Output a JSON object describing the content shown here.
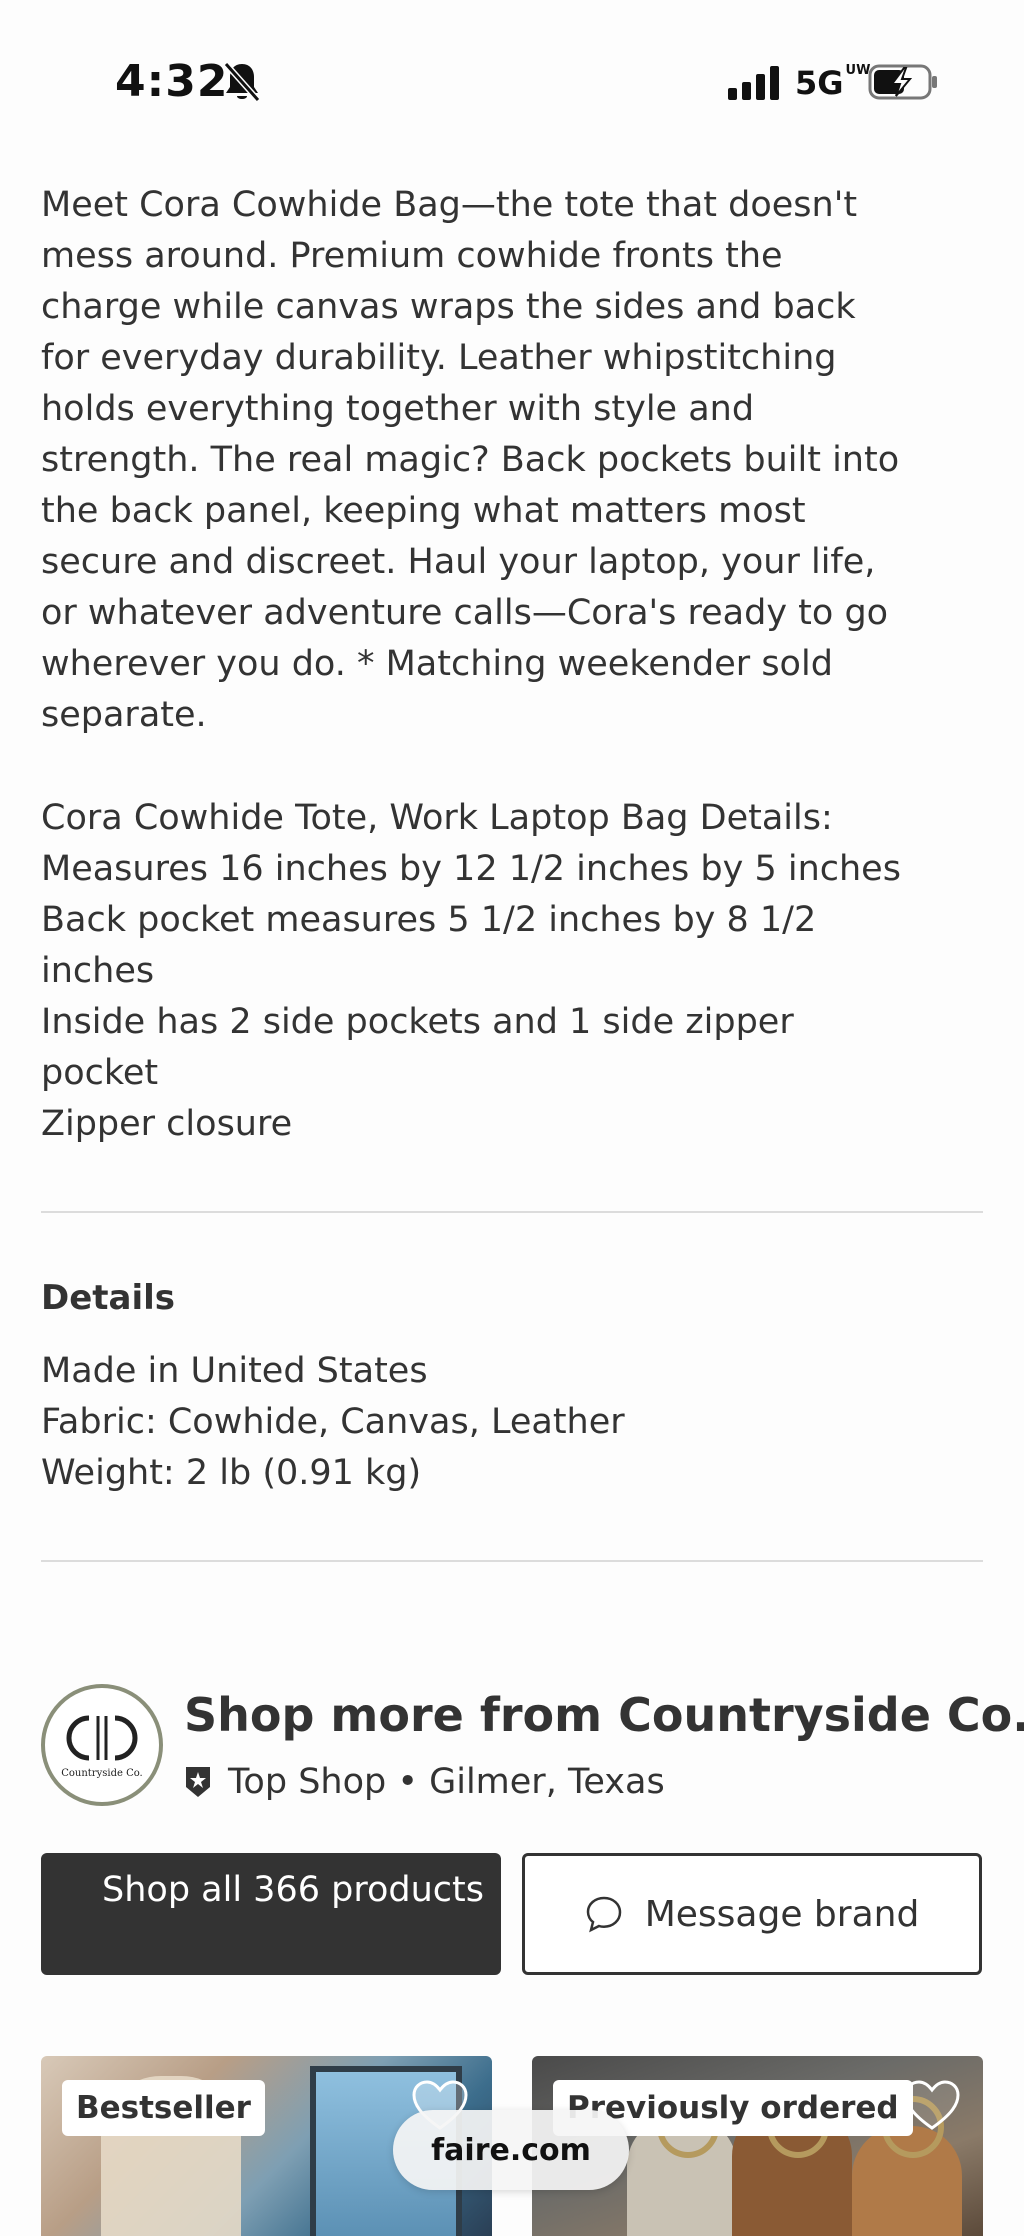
{
  "status_bar": {
    "time": "4:32",
    "network": "5G",
    "network_badge": "UW",
    "icons": [
      "bell-slash-icon",
      "signal-icon",
      "battery-charging-icon"
    ]
  },
  "description": {
    "paragraph_1": "Meet Cora Cowhide Bag—the tote that doesn't mess around. Premium cowhide fronts the charge while canvas wraps the sides and back for everyday durability. Leather whipstitching holds everything together with style and strength. The real magic? Back pockets built into the back panel, keeping what matters most secure and discreet. Haul your laptop, your life, or whatever adventure calls—Cora's ready to go wherever you do. * Matching weekender sold separate.",
    "spec_lines": [
      "Cora Cowhide Tote, Work Laptop Bag Details:",
      "Measures 16 inches by 12 1/2 inches by 5 inches",
      "Back pocket measures 5 1/2 inches by 8 1/2 inches",
      "Inside has 2 side pockets and 1 side zipper pocket",
      "Zipper closure"
    ]
  },
  "details": {
    "heading": "Details",
    "lines": [
      "Made in United States",
      "Fabric: Cowhide, Canvas, Leather",
      "Weight: 2 lb (0.91 kg)"
    ]
  },
  "shop": {
    "logo_text": "Countryside Co.",
    "title": "Shop more from Countryside Co.",
    "subtitle": "Top Shop • Gilmer, Texas",
    "shop_all_label": "Shop all 366 products",
    "message_label": "Message brand"
  },
  "products": [
    {
      "badge": "Bestseller",
      "favorite_icon": "heart-icon"
    },
    {
      "badge": "Previously ordered",
      "favorite_icon": "heart-icon"
    }
  ],
  "browser": {
    "domain": "faire.com"
  },
  "colors": {
    "text": "#333333",
    "primary_button": "#333333",
    "logo_ring": "#8a8f79",
    "divider": "#dcdcdc"
  }
}
